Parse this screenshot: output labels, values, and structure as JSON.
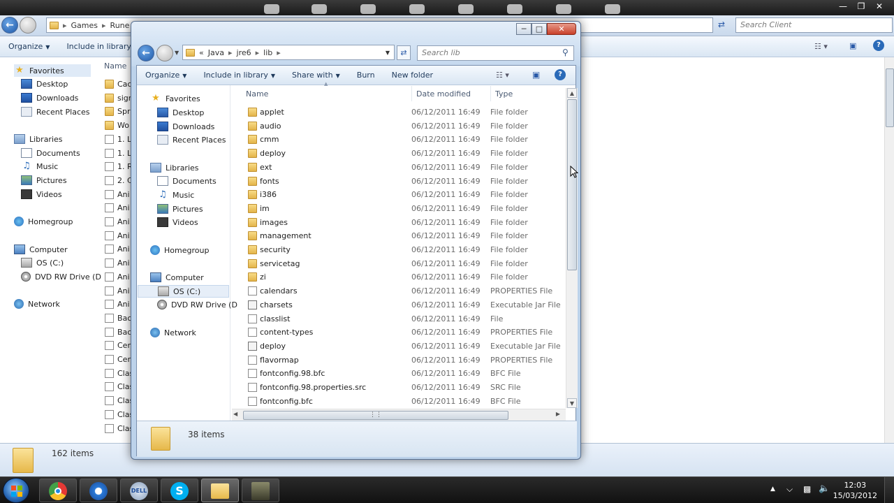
{
  "background_window": {
    "breadcrumb": [
      "Games",
      "Rune"
    ],
    "search_placeholder": "Search Client",
    "toolbar": {
      "organize": "Organize",
      "include": "Include in library"
    },
    "name_header": "Name",
    "nav": {
      "favorites": "Favorites",
      "desktop": "Desktop",
      "downloads": "Downloads",
      "recent": "Recent Places",
      "libraries": "Libraries",
      "documents": "Documents",
      "music": "Music",
      "pictures": "Pictures",
      "videos": "Videos",
      "homegroup": "Homegroup",
      "computer": "Computer",
      "osc": "OS (C:)",
      "dvd": "DVD RW Drive (D",
      "network": "Network"
    },
    "files": [
      "Cac",
      "sign",
      "Spri",
      "Wo",
      "1. L",
      "1. L",
      "1. R",
      "2. C",
      "Ani",
      "Ani",
      "Ani",
      "Ani",
      "Ani",
      "Ani",
      "Ani",
      "Ani",
      "Ani",
      "Bac",
      "Bac",
      "Cer",
      "Cer",
      "Clas",
      "Clas",
      "Clas",
      "Clas",
      "Clas"
    ],
    "status": "162 items"
  },
  "foreground_window": {
    "breadcrumb": {
      "prefix": "«",
      "part1": "Java",
      "part2": "jre6",
      "part3": "lib"
    },
    "search_placeholder": "Search lib",
    "toolbar": {
      "organize": "Organize",
      "include": "Include in library",
      "share": "Share with",
      "burn": "Burn",
      "new_folder": "New folder"
    },
    "nav": {
      "favorites": "Favorites",
      "desktop": "Desktop",
      "downloads": "Downloads",
      "recent": "Recent Places",
      "libraries": "Libraries",
      "documents": "Documents",
      "music": "Music",
      "pictures": "Pictures",
      "videos": "Videos",
      "homegroup": "Homegroup",
      "computer": "Computer",
      "osc": "OS (C:)",
      "dvd": "DVD RW Drive (D",
      "network": "Network"
    },
    "columns": {
      "name": "Name",
      "date": "Date modified",
      "type": "Type"
    },
    "rows": [
      {
        "name": "applet",
        "date": "06/12/2011 16:49",
        "type": "File folder",
        "kind": "folder"
      },
      {
        "name": "audio",
        "date": "06/12/2011 16:49",
        "type": "File folder",
        "kind": "folder"
      },
      {
        "name": "cmm",
        "date": "06/12/2011 16:49",
        "type": "File folder",
        "kind": "folder"
      },
      {
        "name": "deploy",
        "date": "06/12/2011 16:49",
        "type": "File folder",
        "kind": "folder"
      },
      {
        "name": "ext",
        "date": "06/12/2011 16:49",
        "type": "File folder",
        "kind": "folder"
      },
      {
        "name": "fonts",
        "date": "06/12/2011 16:49",
        "type": "File folder",
        "kind": "folder"
      },
      {
        "name": "i386",
        "date": "06/12/2011 16:49",
        "type": "File folder",
        "kind": "folder"
      },
      {
        "name": "im",
        "date": "06/12/2011 16:49",
        "type": "File folder",
        "kind": "folder"
      },
      {
        "name": "images",
        "date": "06/12/2011 16:49",
        "type": "File folder",
        "kind": "folder"
      },
      {
        "name": "management",
        "date": "06/12/2011 16:49",
        "type": "File folder",
        "kind": "folder"
      },
      {
        "name": "security",
        "date": "06/12/2011 16:49",
        "type": "File folder",
        "kind": "folder"
      },
      {
        "name": "servicetag",
        "date": "06/12/2011 16:49",
        "type": "File folder",
        "kind": "folder"
      },
      {
        "name": "zi",
        "date": "06/12/2011 16:49",
        "type": "File folder",
        "kind": "folder"
      },
      {
        "name": "calendars",
        "date": "06/12/2011 16:49",
        "type": "PROPERTIES File",
        "kind": "file"
      },
      {
        "name": "charsets",
        "date": "06/12/2011 16:49",
        "type": "Executable Jar File",
        "kind": "jar"
      },
      {
        "name": "classlist",
        "date": "06/12/2011 16:49",
        "type": "File",
        "kind": "file"
      },
      {
        "name": "content-types",
        "date": "06/12/2011 16:49",
        "type": "PROPERTIES File",
        "kind": "file"
      },
      {
        "name": "deploy",
        "date": "06/12/2011 16:49",
        "type": "Executable Jar File",
        "kind": "jar"
      },
      {
        "name": "flavormap",
        "date": "06/12/2011 16:49",
        "type": "PROPERTIES File",
        "kind": "file"
      },
      {
        "name": "fontconfig.98.bfc",
        "date": "06/12/2011 16:49",
        "type": "BFC File",
        "kind": "file"
      },
      {
        "name": "fontconfig.98.properties.src",
        "date": "06/12/2011 16:49",
        "type": "SRC File",
        "kind": "file"
      },
      {
        "name": "fontconfig.bfc",
        "date": "06/12/2011 16:49",
        "type": "BFC File",
        "kind": "file"
      }
    ],
    "status": "38 items"
  },
  "taskbar": {
    "time": "12:03",
    "date": "15/03/2012",
    "apps": [
      "chrome-icon",
      "app-icon",
      "dell-icon",
      "skype-icon",
      "explorer-icon",
      "java-icon"
    ]
  }
}
